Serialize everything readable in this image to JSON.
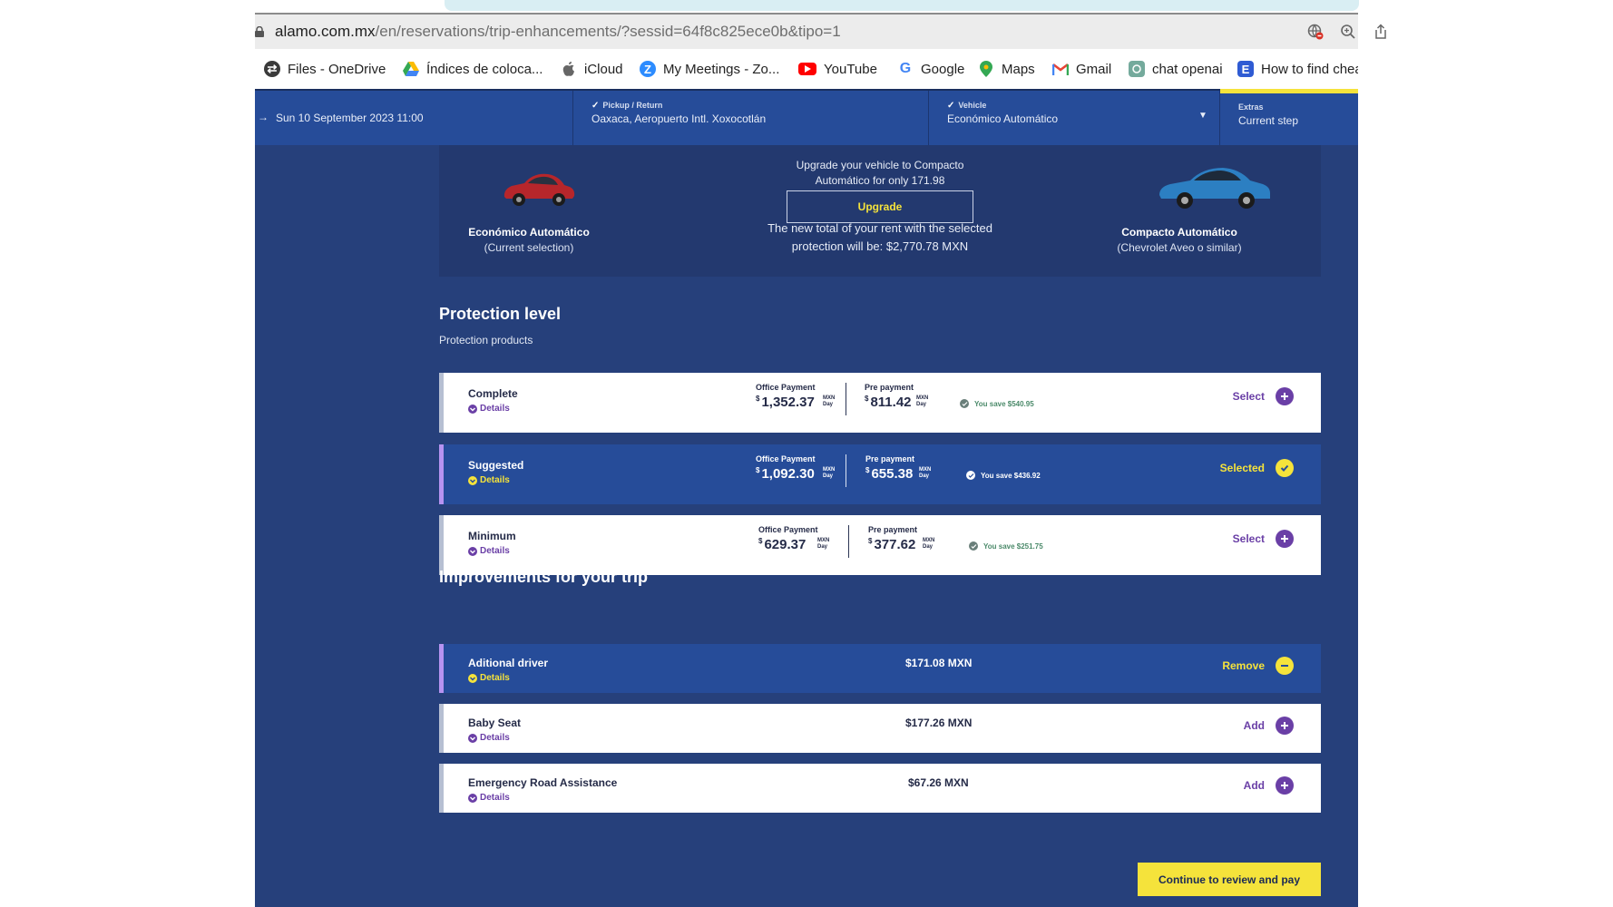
{
  "browser": {
    "url_domain": "alamo.com.mx",
    "url_path": "/en/reservations/trip-enhancements/?sessid=64f8c825ece0b&tipo=1",
    "bookmarks": [
      {
        "label": "Files - OneDrive",
        "icon": "onedrive-icon"
      },
      {
        "label": "Índices de coloca...",
        "icon": "google-drive-icon"
      },
      {
        "label": "iCloud",
        "icon": "apple-icon"
      },
      {
        "label": "My Meetings - Zo...",
        "icon": "zoom-icon"
      },
      {
        "label": "YouTube",
        "icon": "youtube-icon"
      },
      {
        "label": "Google",
        "icon": "google-icon"
      },
      {
        "label": "Maps",
        "icon": "maps-icon"
      },
      {
        "label": "Gmail",
        "icon": "gmail-icon"
      },
      {
        "label": "chat openai",
        "icon": "openai-icon"
      },
      {
        "label": "How to find chea",
        "icon": "e-icon"
      }
    ]
  },
  "steps": {
    "date": "Sun 10 September 2023 11:00",
    "pickup_label": "Pickup / Return",
    "pickup_value": "Oaxaca, Aeropuerto Intl. Xoxocotlán",
    "vehicle_label": "Vehicle",
    "vehicle_value": "Económico Automático",
    "extras_label": "Extras",
    "extras_value": "Current step"
  },
  "upgrade": {
    "current_name": "Económico Automático",
    "current_sub": "(Current selection)",
    "offer_line1": "Upgrade your vehicle to Compacto",
    "offer_line2": "Automático for only 171.98",
    "button": "Upgrade",
    "total_line1": "The new total of your rent with the selected",
    "total_line2": "protection will be: $2,770.78 MXN",
    "upgrade_name": "Compacto Automático",
    "upgrade_sub": "(Chevrolet Aveo o similar)"
  },
  "protection": {
    "title": "Protection level",
    "subtitle": "Protection products",
    "office_label": "Office Payment",
    "pre_label": "Pre payment",
    "currency_symbol": "$",
    "unit_currency": "MXN",
    "unit_period": "Day",
    "details_label": "Details",
    "items": [
      {
        "name": "Complete",
        "office": "1,352.37",
        "pre": "811.42",
        "save": "You save $540.95",
        "action": "Select",
        "selected": false
      },
      {
        "name": "Suggested",
        "office": "1,092.30",
        "pre": "655.38",
        "save": "You save $436.92",
        "action": "Selected",
        "selected": true
      },
      {
        "name": "Minimum",
        "office": "629.37",
        "pre": "377.62",
        "save": "You save $251.75",
        "action": "Select",
        "selected": false
      }
    ]
  },
  "improvements": {
    "title": "Improvements for your trip",
    "details_label": "Details",
    "items": [
      {
        "name": "Aditional driver",
        "price": "$171.08 MXN",
        "action": "Remove",
        "selected": true
      },
      {
        "name": "Baby Seat",
        "price": "$177.26 MXN",
        "action": "Add",
        "selected": false
      },
      {
        "name": "Emergency Road Assistance",
        "price": "$67.26 MXN",
        "action": "Add",
        "selected": false
      }
    ]
  },
  "cta": {
    "label": "Continue to review and pay"
  },
  "colors": {
    "brand_blue": "#264c99",
    "page_navy": "#26407b",
    "accent_yellow": "#f5e33b",
    "accent_purple": "#6a3fa6"
  }
}
